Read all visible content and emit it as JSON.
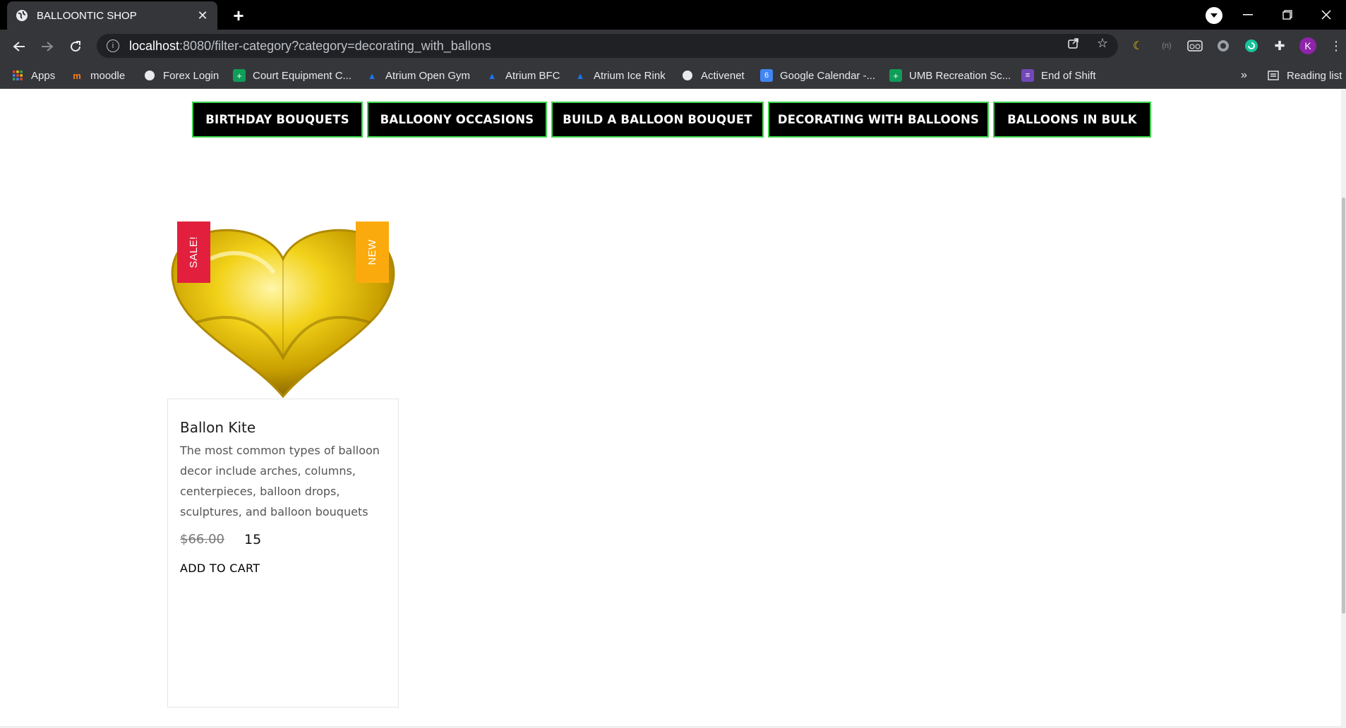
{
  "browser": {
    "tab_title": "BALLOONTIC SHOP",
    "url_host": "localhost",
    "url_rest": ":8080/filter-category?category=decorating_with_ballons",
    "profile_initial": "K"
  },
  "bookmarks": [
    {
      "label": "Apps",
      "icon": "apps-grid-icon"
    },
    {
      "label": "moodle",
      "icon": "moodle-icon"
    },
    {
      "label": "Forex Login",
      "icon": "globe-icon"
    },
    {
      "label": "Court Equipment C...",
      "icon": "sheets-icon"
    },
    {
      "label": "Atrium Open Gym",
      "icon": "activenet-icon"
    },
    {
      "label": "Atrium BFC",
      "icon": "activenet-icon"
    },
    {
      "label": "Atrium Ice Rink",
      "icon": "activenet-icon"
    },
    {
      "label": "Activenet",
      "icon": "globe-icon"
    },
    {
      "label": "Google Calendar -...",
      "icon": "calendar-icon"
    },
    {
      "label": "UMB Recreation Sc...",
      "icon": "sheets-icon"
    },
    {
      "label": "End of Shift",
      "icon": "forms-icon"
    }
  ],
  "bookmarks_more": "»",
  "reading_list": "Reading list",
  "categories": [
    {
      "label": "BIRTHDAY BOUQUETS"
    },
    {
      "label": "BALLOONY OCCASIONS"
    },
    {
      "label": "BUILD A BALLOON BOUQUET"
    },
    {
      "label": "DECORATING WITH BALLOONS"
    },
    {
      "label": "BALLOONS IN BULK"
    }
  ],
  "product": {
    "sale_badge": "SALE!",
    "new_badge": "NEW",
    "name": "Ballon Kite",
    "description": "The most common types of balloon decor include arches, columns, centerpieces, balloon drops, sculptures, and balloon bouquets",
    "old_price": "$66.00",
    "price": "15",
    "add_to_cart": "ADD TO CART"
  },
  "colors": {
    "nav_border": "#3bd44a",
    "sale": "#e2203d",
    "new": "#fbaa0e"
  }
}
